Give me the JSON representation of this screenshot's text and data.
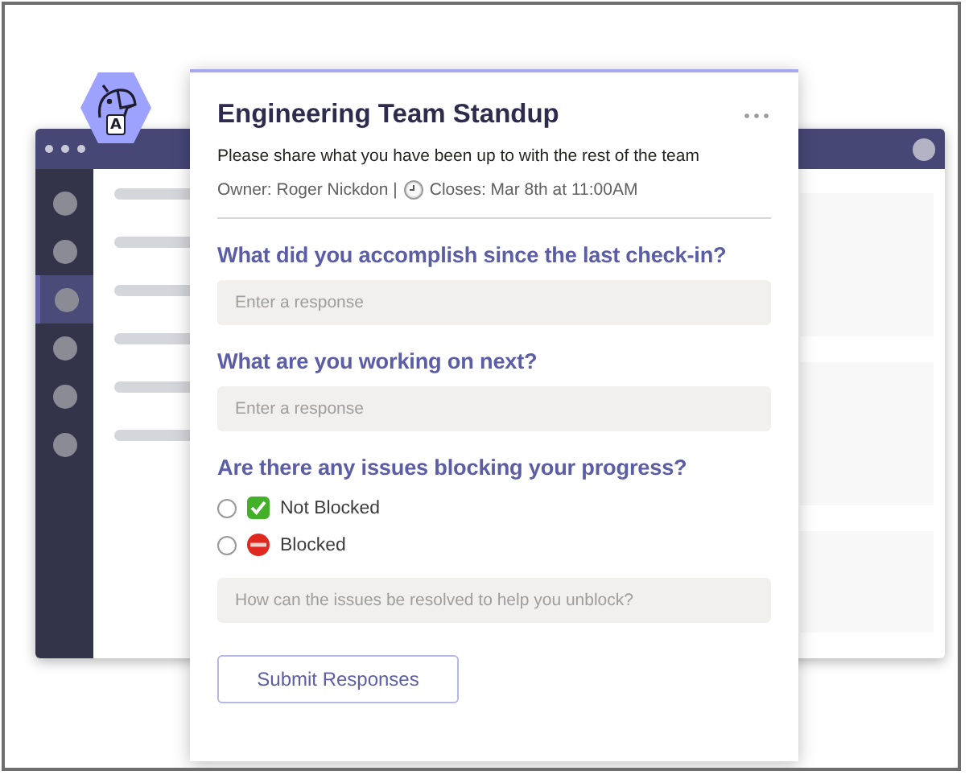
{
  "app_window": {
    "rail_items": [
      {
        "selected": false
      },
      {
        "selected": false
      },
      {
        "selected": true
      },
      {
        "selected": false
      },
      {
        "selected": false
      },
      {
        "selected": false
      }
    ]
  },
  "badge": {
    "letter": "A"
  },
  "card": {
    "title": "Engineering Team Standup",
    "description": "Please share what you have been up to with the rest of the team",
    "owner": "Owner: Roger Nickdon |",
    "closes": "Closes: Mar 8th at 11:00AM",
    "questions": [
      {
        "kind": "text",
        "label": "What did you accomplish since the last check-in?",
        "placeholder": "Enter a response"
      },
      {
        "kind": "text",
        "label": "What are you working on next?",
        "placeholder": "Enter a response"
      },
      {
        "kind": "choice",
        "label": "Are there any issues blocking your progress?",
        "options": [
          {
            "kind": "check",
            "label": "Not Blocked",
            "selected": false
          },
          {
            "kind": "stop",
            "label": "Blocked",
            "selected": false
          }
        ],
        "placeholder": "How can the issues be resolved to help you unblock?"
      }
    ],
    "submit": "Submit Responses"
  }
}
